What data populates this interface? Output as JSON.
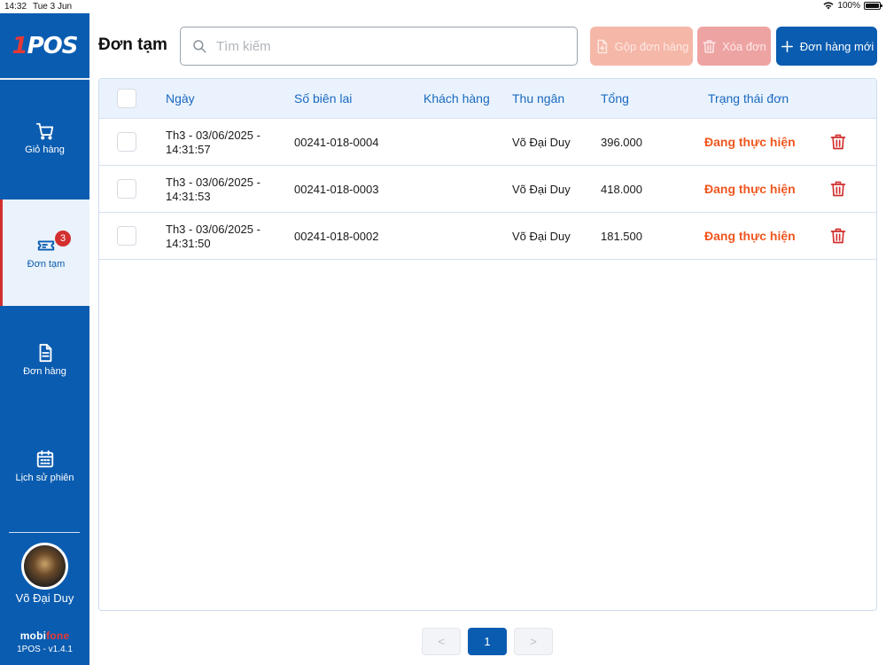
{
  "status_bar": {
    "time": "14:32",
    "date": "Tue 3 Jun",
    "battery": "100%"
  },
  "sidebar": {
    "logo_one": "1",
    "logo_rest": "POS",
    "items": [
      {
        "label": "Giỏ hàng",
        "icon": "cart-icon"
      },
      {
        "label": "Đơn tạm",
        "icon": "ticket-icon",
        "badge": "3",
        "active": true
      },
      {
        "label": "Đơn hàng",
        "icon": "document-icon"
      },
      {
        "label": "Lịch sử phiên",
        "icon": "calendar-icon"
      }
    ],
    "user_name": "Võ Đại Duy",
    "brand_mobi": "mobi",
    "brand_fone": "fone",
    "version": "1POS - v1.4.1"
  },
  "header": {
    "title": "Đơn tạm",
    "search_placeholder": "Tìm kiếm",
    "merge_label": "Gộp đơn hàng",
    "delete_label": "Xóa đơn",
    "new_label": "Đơn hàng mới"
  },
  "table": {
    "columns": [
      "Ngày",
      "Số biên lai",
      "Khách hàng",
      "Thu ngân",
      "Tổng",
      "Trạng thái đơn"
    ],
    "rows": [
      {
        "date_line1": "Th3 - 03/06/2025 -",
        "date_line2": "14:31:57",
        "receipt": "00241-018-0004",
        "customer": "",
        "cashier": "Võ Đại Duy",
        "total": "396.000",
        "status": "Đang thực hiện"
      },
      {
        "date_line1": "Th3 - 03/06/2025 -",
        "date_line2": "14:31:53",
        "receipt": "00241-018-0003",
        "customer": "",
        "cashier": "Võ Đại Duy",
        "total": "418.000",
        "status": "Đang thực hiện"
      },
      {
        "date_line1": "Th3 - 03/06/2025 -",
        "date_line2": "14:31:50",
        "receipt": "00241-018-0002",
        "customer": "",
        "cashier": "Võ Đại Duy",
        "total": "181.500",
        "status": "Đang thực hiện"
      }
    ]
  },
  "pagination": {
    "prev": "<",
    "current": "1",
    "next": ">"
  },
  "colors": {
    "primary": "#0a5cb0",
    "status": "#f0561f",
    "danger": "#d32f2f"
  }
}
